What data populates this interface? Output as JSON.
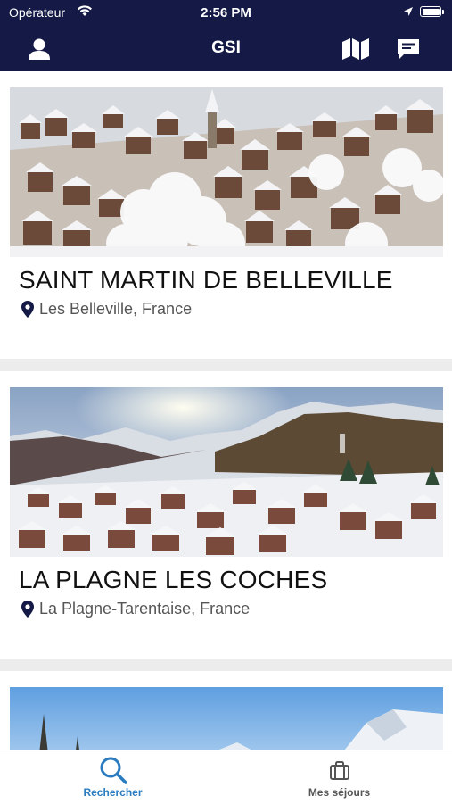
{
  "status_bar": {
    "carrier": "Opérateur",
    "time": "2:56 PM"
  },
  "nav_bar": {
    "title": "GSI",
    "icons": [
      "user-icon",
      "map-icon",
      "chat-icon"
    ]
  },
  "resorts": [
    {
      "name": "SAINT MARTIN DE BELLEVILLE",
      "location": "Les Belleville, France"
    },
    {
      "name": "LA PLAGNE LES COCHES",
      "location": "La Plagne-Tarentaise, France"
    }
  ],
  "tab_bar": {
    "tabs": [
      {
        "label": "Rechercher",
        "icon": "search-icon",
        "active": true
      },
      {
        "label": "Mes séjours",
        "icon": "suitcase-icon",
        "active": false
      }
    ]
  },
  "colors": {
    "nav_background": "#141a45",
    "active_tab": "#2a7bbf",
    "inactive_tab": "#555555"
  }
}
